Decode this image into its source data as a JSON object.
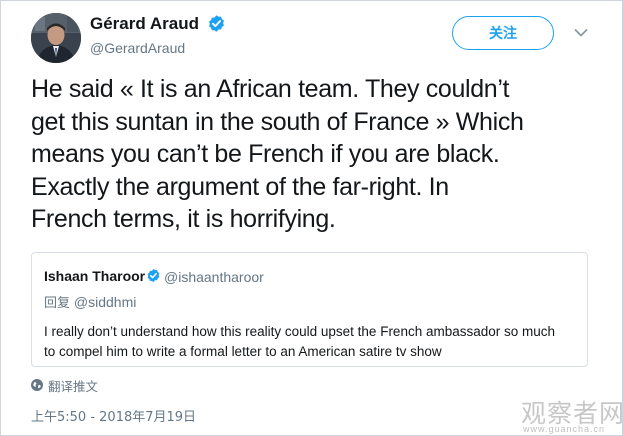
{
  "author": {
    "name": "Gérard Araud",
    "handle": "@GerardAraud"
  },
  "actions": {
    "follow_label": "关注"
  },
  "tweet": {
    "text": "He said « It is an African team. They couldn’t\nget this suntan in the south of France » Which\nmeans you can’t be French if you are black.\nExactly the argument of the far-right. In\nFrench terms, it is horrifying."
  },
  "quote": {
    "name": "Ishaan Tharoor",
    "handle": "@ishaantharoor",
    "reply_prefix": "回复",
    "reply_to": "@siddhmi",
    "text": "I really don’t understand how this reality could upset the French ambassador so much\nto compel him to write a formal letter to an American satire tv show"
  },
  "footer": {
    "translate_label": "翻译推文",
    "timestamp": "上午5:50 - 2018年7月19日"
  },
  "watermark": {
    "text": "观察者网",
    "sub": "www.guancha.cn"
  },
  "colors": {
    "accent": "#1da1f2",
    "secondary_text": "#657786",
    "primary_text": "#14171a",
    "border": "#d9dfe4"
  },
  "icons": {
    "verified": "verified-badge-icon",
    "caret": "chevron-down-icon",
    "globe": "globe-icon"
  }
}
